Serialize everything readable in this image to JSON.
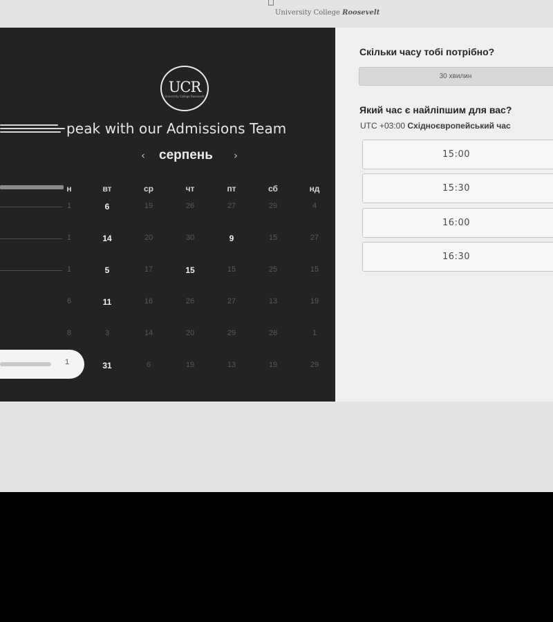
{
  "header": {
    "logo_mark": "UCR",
    "logo_tagline_prefix": "University College ",
    "logo_tagline_name": "Roosevelt"
  },
  "calendar": {
    "badge_text": "UCR",
    "badge_subtext": "University College Roosevelt",
    "title": "peak with our Admissions Team",
    "month": "серпень",
    "prev_icon": "‹",
    "next_icon": "›",
    "weekdays": [
      "н",
      "вт",
      "ср",
      "чт",
      "пт",
      "сб",
      "нд"
    ],
    "rows": [
      [
        "1",
        "6",
        "19",
        "26",
        "27",
        "29",
        "4"
      ],
      [
        "1",
        "14",
        "20",
        "30",
        "9",
        "15",
        "27"
      ],
      [
        "1",
        "5",
        "17",
        "15",
        "15",
        "25",
        "15"
      ],
      [
        "6",
        "11",
        "16",
        "26",
        "27",
        "13",
        "19"
      ],
      [
        "8",
        "3",
        "14",
        "20",
        "29",
        "28",
        "1"
      ],
      [
        "1",
        "31",
        "6",
        "19",
        "13",
        "19",
        "29"
      ]
    ],
    "available": [
      [
        1,
        0
      ],
      [
        1,
        1
      ],
      [
        1,
        2
      ],
      [
        1,
        3
      ],
      [
        4,
        1
      ],
      [
        3,
        2
      ],
      [
        1,
        4
      ],
      [
        1,
        5
      ]
    ]
  },
  "booking": {
    "duration_question": "Скільки часу тобі потрібно?",
    "duration_value": "30 хвилин",
    "time_question": "Який час є найліпшим для вас?",
    "tz_offset": "UTC +03:00",
    "tz_name": "Східноєвропейський час",
    "slots": [
      "15:00",
      "15:30",
      "16:00",
      "16:30"
    ]
  }
}
